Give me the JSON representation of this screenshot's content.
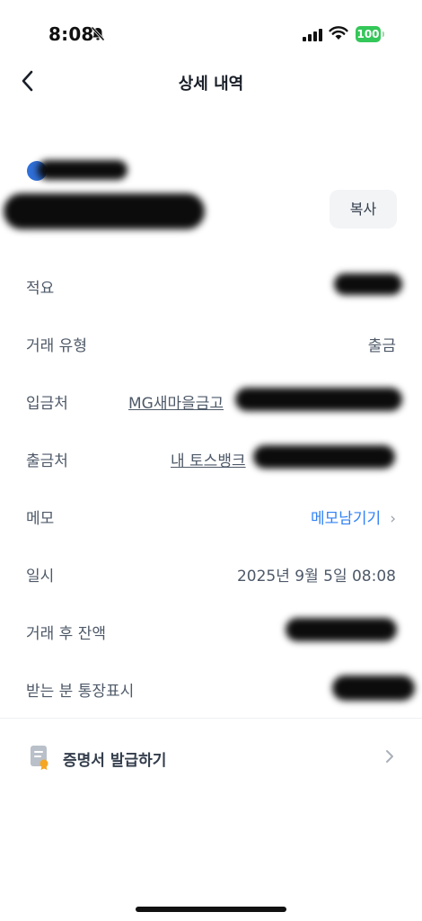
{
  "status_bar": {
    "time": "8:08",
    "battery": "100"
  },
  "header": {
    "title": "상세 내역"
  },
  "account": {
    "copy_label": "복사"
  },
  "details": [
    {
      "label": "적요",
      "value": ""
    },
    {
      "label": "거래 유형",
      "value": "출금"
    },
    {
      "label": "입금처",
      "value": "MG새마을금고"
    },
    {
      "label": "출금처",
      "value": "내 토스뱅크"
    },
    {
      "label": "메모",
      "value": "메모남기기"
    },
    {
      "label": "일시",
      "value": "2025년 9월 5일 08:08"
    },
    {
      "label": "거래 후 잔액",
      "value": ""
    },
    {
      "label": "받는 분 통장표시",
      "value": ""
    }
  ],
  "certificate": {
    "label": "증명서 발급하기"
  },
  "colors": {
    "accent": "#3182f6",
    "battery": "#34c759"
  }
}
